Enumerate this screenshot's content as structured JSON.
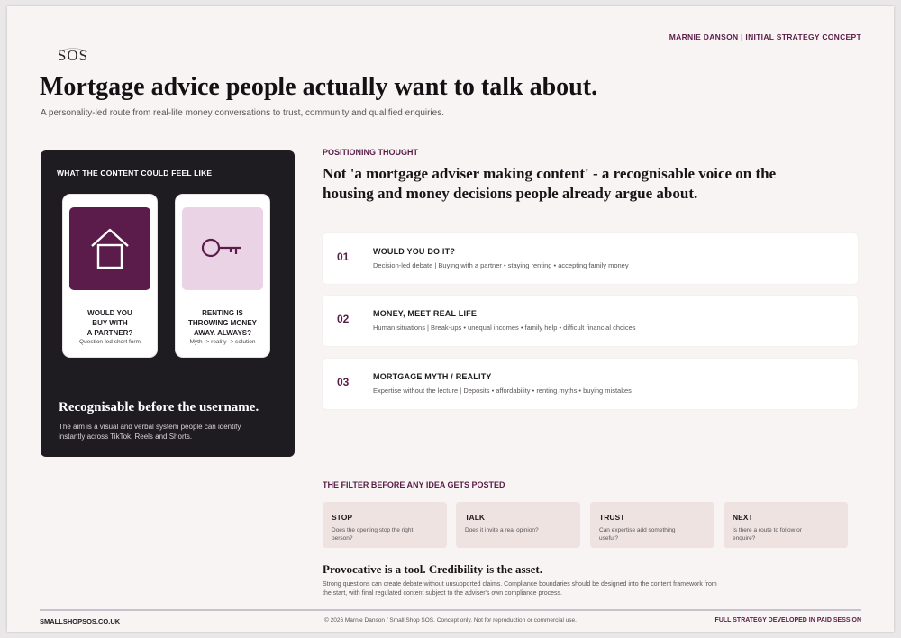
{
  "brand": {
    "logo_text": "SOS"
  },
  "header": {
    "right_label": "MARNIE DANSON  |  INITIAL STRATEGY CONCEPT",
    "title": "Mortgage advice people actually want to talk about.",
    "subtitle": "A personality-led route from real-life money conversations to trust, community and qualified enquiries."
  },
  "content_panel": {
    "label": "WHAT THE CONTENT COULD FEEL LIKE",
    "phones": [
      {
        "icon": "house-icon",
        "caption": "WOULD YOU\nBUY WITH\nA PARTNER?",
        "format": "Question-led short form"
      },
      {
        "icon": "key-icon",
        "caption": "RENTING IS\nTHROWING MONEY\nAWAY. ALWAYS?",
        "format": "Myth -> reality -> solution"
      }
    ],
    "heading": "Recognisable before the username.",
    "body": "The aim is a visual and verbal system people can identify instantly across TikTok, Reels and Shorts."
  },
  "positioning": {
    "label": "POSITIONING THOUGHT",
    "quote": "Not 'a mortgage adviser making content' - a recognisable voice on the housing and money decisions people already argue about."
  },
  "pillars": [
    {
      "number": "01",
      "title": "WOULD YOU DO IT?",
      "desc": "Decision-led debate  |  Buying with a partner • staying renting • accepting family money"
    },
    {
      "number": "02",
      "title": "MONEY, MEET REAL LIFE",
      "desc": "Human situations  |  Break-ups • unequal incomes • family help • difficult financial choices"
    },
    {
      "number": "03",
      "title": "MORTGAGE MYTH / REALITY",
      "desc": "Expertise without the lecture  |  Deposits • affordability • renting myths • buying mistakes"
    }
  ],
  "filter": {
    "label": "THE FILTER BEFORE ANY IDEA GETS POSTED",
    "steps": [
      {
        "title": "STOP",
        "desc": "Does the opening stop the right person?"
      },
      {
        "title": "TALK",
        "desc": "Does it invite a real opinion?"
      },
      {
        "title": "TRUST",
        "desc": "Can expertise add something useful?"
      },
      {
        "title": "NEXT",
        "desc": "Is there a route to follow or enquire?"
      }
    ]
  },
  "provocative": {
    "heading": "Provocative is a tool. Credibility is the asset.",
    "body": "Strong questions can create debate without unsupported claims. Compliance boundaries should be designed into the content framework from the start, with final regulated content subject to the adviser's own compliance process."
  },
  "footer": {
    "left": "SMALLSHOPSOS.CO.UK",
    "center": "© 2026 Marnie Danson / Small Shop SOS. Concept only. Not for reproduction or commercial use.",
    "right": "FULL STRATEGY DEVELOPED IN PAID SESSION"
  },
  "colors": {
    "accent": "#5a1d47",
    "tile_dark": "#5c1c4b",
    "tile_light": "#ebd3e6",
    "panel_dark": "#1e1b21",
    "page_bg": "#f8f4f3"
  }
}
